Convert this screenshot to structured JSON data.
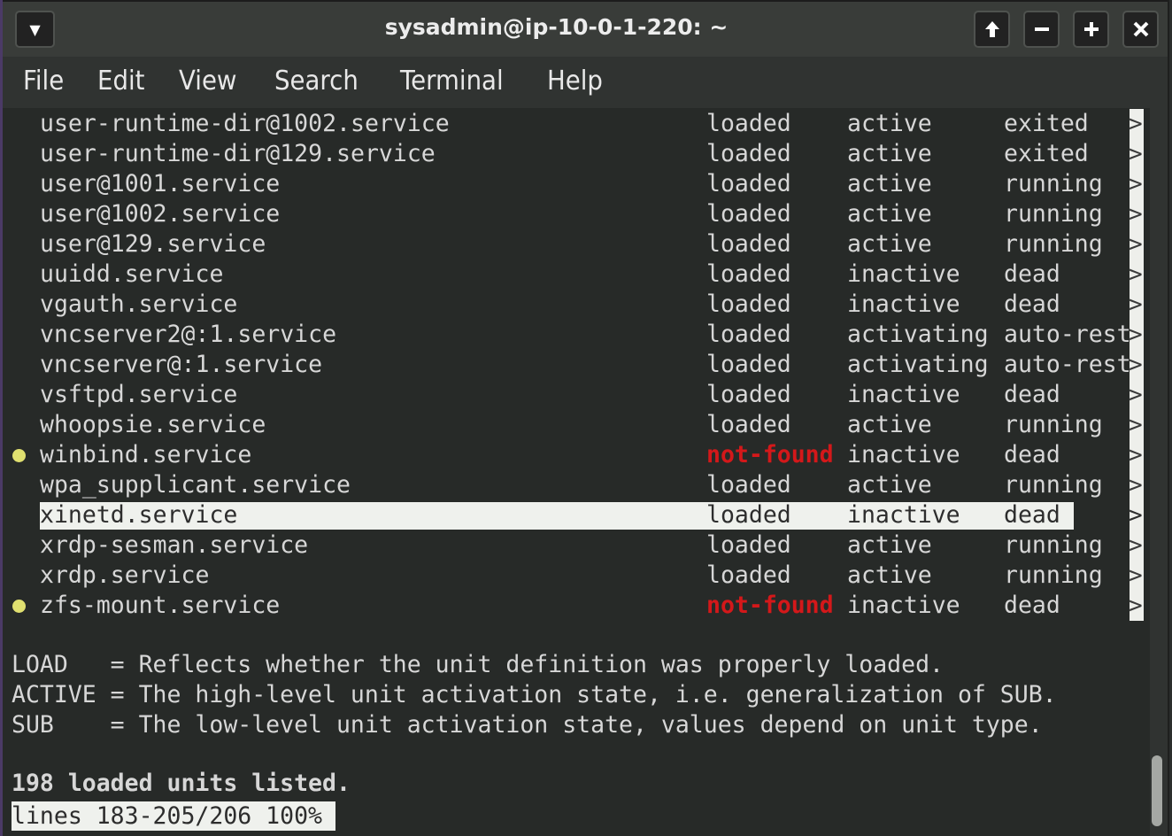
{
  "window": {
    "title": "sysadmin@ip-10-0-1-220: ~",
    "buttons": {
      "menu": "▾",
      "maximize": "🡅",
      "minimize": "−",
      "zoom_in": "+",
      "close": "✕"
    }
  },
  "menubar": {
    "items": [
      "File",
      "Edit",
      "View",
      "Search",
      "Terminal",
      "Help"
    ]
  },
  "units": [
    {
      "name": "user-runtime-dir@1002.service",
      "load": "loaded",
      "active": "active",
      "sub": "exited",
      "marker": false,
      "selected": false
    },
    {
      "name": "user-runtime-dir@129.service",
      "load": "loaded",
      "active": "active",
      "sub": "exited",
      "marker": false,
      "selected": false
    },
    {
      "name": "user@1001.service",
      "load": "loaded",
      "active": "active",
      "sub": "running",
      "marker": false,
      "selected": false
    },
    {
      "name": "user@1002.service",
      "load": "loaded",
      "active": "active",
      "sub": "running",
      "marker": false,
      "selected": false
    },
    {
      "name": "user@129.service",
      "load": "loaded",
      "active": "active",
      "sub": "running",
      "marker": false,
      "selected": false
    },
    {
      "name": "uuidd.service",
      "load": "loaded",
      "active": "inactive",
      "sub": "dead",
      "marker": false,
      "selected": false
    },
    {
      "name": "vgauth.service",
      "load": "loaded",
      "active": "inactive",
      "sub": "dead",
      "marker": false,
      "selected": false
    },
    {
      "name": "vncserver2@:1.service",
      "load": "loaded",
      "active": "activating",
      "sub": "auto-rest",
      "marker": false,
      "selected": false
    },
    {
      "name": "vncserver@:1.service",
      "load": "loaded",
      "active": "activating",
      "sub": "auto-rest",
      "marker": false,
      "selected": false
    },
    {
      "name": "vsftpd.service",
      "load": "loaded",
      "active": "inactive",
      "sub": "dead",
      "marker": false,
      "selected": false
    },
    {
      "name": "whoopsie.service",
      "load": "loaded",
      "active": "active",
      "sub": "running",
      "marker": false,
      "selected": false
    },
    {
      "name": "winbind.service",
      "load": "not-found",
      "active": "inactive",
      "sub": "dead",
      "marker": true,
      "selected": false
    },
    {
      "name": "wpa_supplicant.service",
      "load": "loaded",
      "active": "active",
      "sub": "running",
      "marker": false,
      "selected": false
    },
    {
      "name": "xinetd.service",
      "load": "loaded",
      "active": "inactive",
      "sub": "dead",
      "marker": false,
      "selected": true
    },
    {
      "name": "xrdp-sesman.service",
      "load": "loaded",
      "active": "active",
      "sub": "running",
      "marker": false,
      "selected": false
    },
    {
      "name": "xrdp.service",
      "load": "loaded",
      "active": "active",
      "sub": "running",
      "marker": false,
      "selected": false
    },
    {
      "name": "zfs-mount.service",
      "load": "not-found",
      "active": "inactive",
      "sub": "dead",
      "marker": true,
      "selected": false
    }
  ],
  "truncation_marker": ">",
  "legend": [
    "LOAD   = Reflects whether the unit definition was properly loaded.",
    "ACTIVE = The high-level unit activation state, i.e. generalization of SUB.",
    "SUB    = The low-level unit activation state, values depend on unit type."
  ],
  "summary": "198 loaded units listed.",
  "pager_status": "lines 183-205/206 100%",
  "colors": {
    "not_found": "#d4181a",
    "marker_dot": "#e0e070",
    "highlight_bg": "#eff1ed",
    "terminal_bg": "#272a28"
  }
}
